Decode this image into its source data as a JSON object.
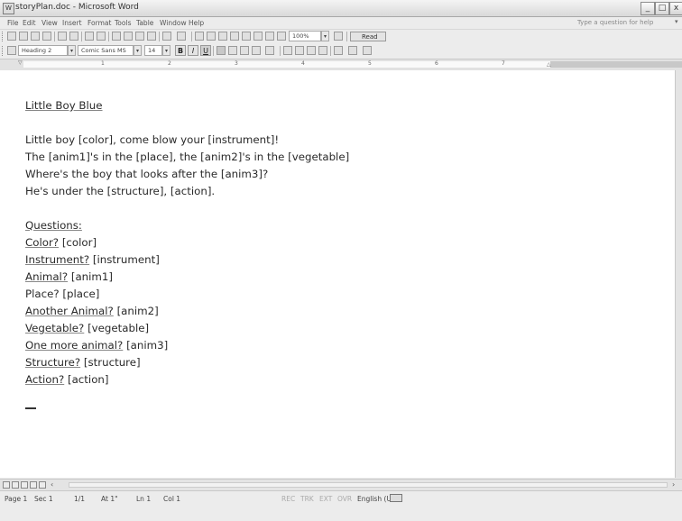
{
  "window": {
    "title": "storyPlan.doc - Microsoft Word"
  },
  "menu": {
    "items": [
      "File",
      "Edit",
      "View",
      "Insert",
      "Format",
      "Tools",
      "Table",
      "Window",
      "Help"
    ],
    "help_placeholder": "Type a question for help"
  },
  "toolbar": {
    "zoom": "100%",
    "read_label": "Read",
    "style": "Heading 2",
    "font": "Comic Sans MS",
    "font_size": "14",
    "bold_label": "B",
    "italic_label": "I",
    "underline_label": "U"
  },
  "ruler": {
    "numbers": [
      "1",
      "2",
      "3",
      "4",
      "5",
      "6",
      "7"
    ]
  },
  "document": {
    "heading": "Little Boy Blue",
    "poem": [
      "Little boy [color], come blow your [instrument]!",
      "The [anim1]'s in the [place], the [anim2]'s in the [vegetable]",
      "Where's the boy that looks after the [anim3]?",
      "He's under the [structure], [action]."
    ],
    "questions_heading": "Questions:",
    "questions": [
      {
        "label": "Color?",
        "value": "[color]",
        "underlined": true
      },
      {
        "label": "Instrument?",
        "value": "[instrument]",
        "underlined": true
      },
      {
        "label": "Animal?",
        "value": "[anim1]",
        "underlined": true
      },
      {
        "label": "Place?",
        "value": "[place]",
        "underlined": false
      },
      {
        "label": "Another Animal?",
        "value": "[anim2]",
        "underlined": true
      },
      {
        "label": "Vegetable?",
        "value": "[vegetable]",
        "underlined": true
      },
      {
        "label": "One more animal?",
        "value": "[anim3]",
        "underlined": true
      },
      {
        "label": "Structure?",
        "value": "[structure]",
        "underlined": true
      },
      {
        "label": "Action?",
        "value": "[action]",
        "underlined": true
      }
    ]
  },
  "status": {
    "page": "Page 1",
    "section": "Sec 1",
    "pages": "1/1",
    "at": "At 1\"",
    "line": "Ln 1",
    "col": "Col 1",
    "rec": "REC",
    "trk": "TRK",
    "ext": "EXT",
    "ovr": "OVR",
    "language": "English (U.S"
  }
}
